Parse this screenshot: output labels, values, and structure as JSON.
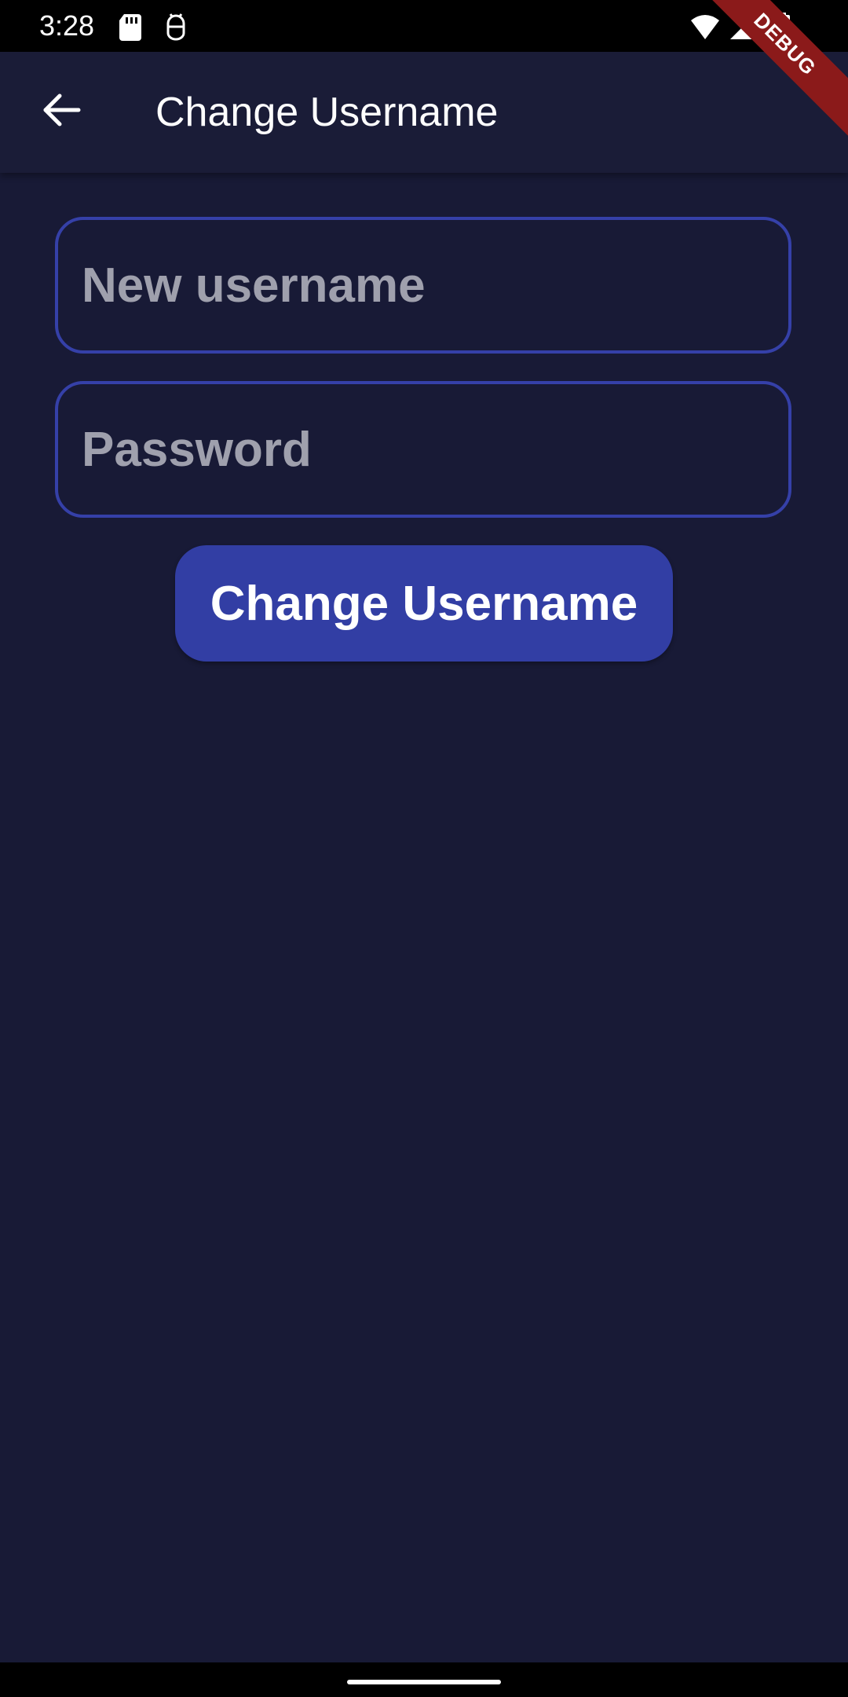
{
  "status_bar": {
    "time": "3:28",
    "icons": [
      "sd-card-icon",
      "android-debug-icon",
      "wifi-icon",
      "signal-icon",
      "battery-icon"
    ]
  },
  "debug_banner": {
    "label": "DEBUG"
  },
  "app_bar": {
    "back_icon": "arrow-left-icon",
    "title": "Change Username"
  },
  "form": {
    "username_placeholder": "New username",
    "username_value": "",
    "password_placeholder": "Password",
    "password_value": "",
    "submit_label": "Change Username"
  },
  "colors": {
    "background": "#181a36",
    "app_bar": "#1a1c37",
    "field_border": "#3540a8",
    "button": "#323ea4",
    "placeholder": "#9fa0ad",
    "debug_banner": "#8b1a1a"
  }
}
